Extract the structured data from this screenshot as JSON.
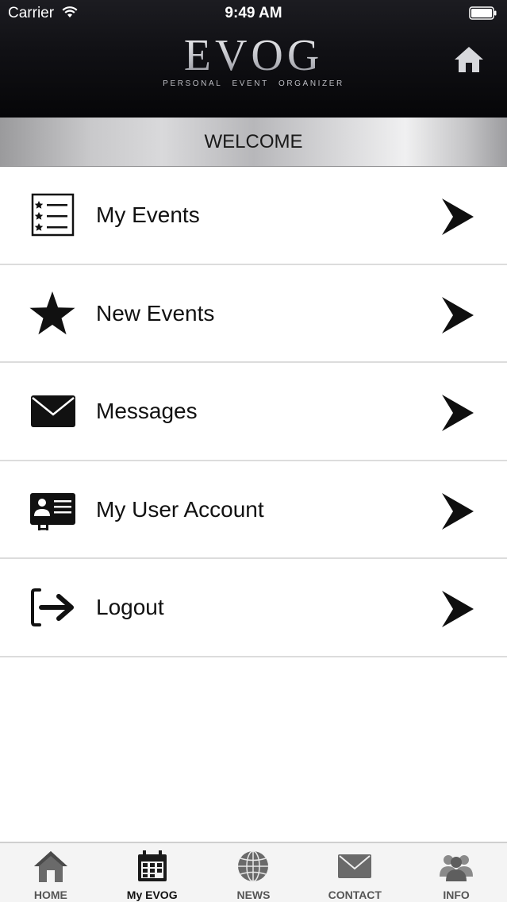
{
  "status_bar": {
    "carrier": "Carrier",
    "time": "9:49 AM"
  },
  "header": {
    "logo_title": "EVOG",
    "logo_subtitle": "PERSONAL EVENT ORGANIZER",
    "home_icon": "home-icon"
  },
  "banner": {
    "title": "WELCOME"
  },
  "menu": {
    "items": [
      {
        "label": "My Events",
        "icon": "event-list-icon"
      },
      {
        "label": "New Events",
        "icon": "star-icon"
      },
      {
        "label": "Messages",
        "icon": "envelope-icon"
      },
      {
        "label": "My User Account",
        "icon": "id-card-icon"
      },
      {
        "label": "Logout",
        "icon": "logout-icon"
      }
    ]
  },
  "tabbar": {
    "active": "My EVOG",
    "tabs": [
      {
        "label": "HOME",
        "icon": "home-icon"
      },
      {
        "label": "My EVOG",
        "icon": "calendar-icon"
      },
      {
        "label": "NEWS",
        "icon": "globe-icon"
      },
      {
        "label": "CONTACT",
        "icon": "envelope-icon"
      },
      {
        "label": "INFO",
        "icon": "users-icon"
      }
    ]
  },
  "colors": {
    "header_bg": "#101014",
    "text": "#111111",
    "tab_inactive": "#555555"
  }
}
